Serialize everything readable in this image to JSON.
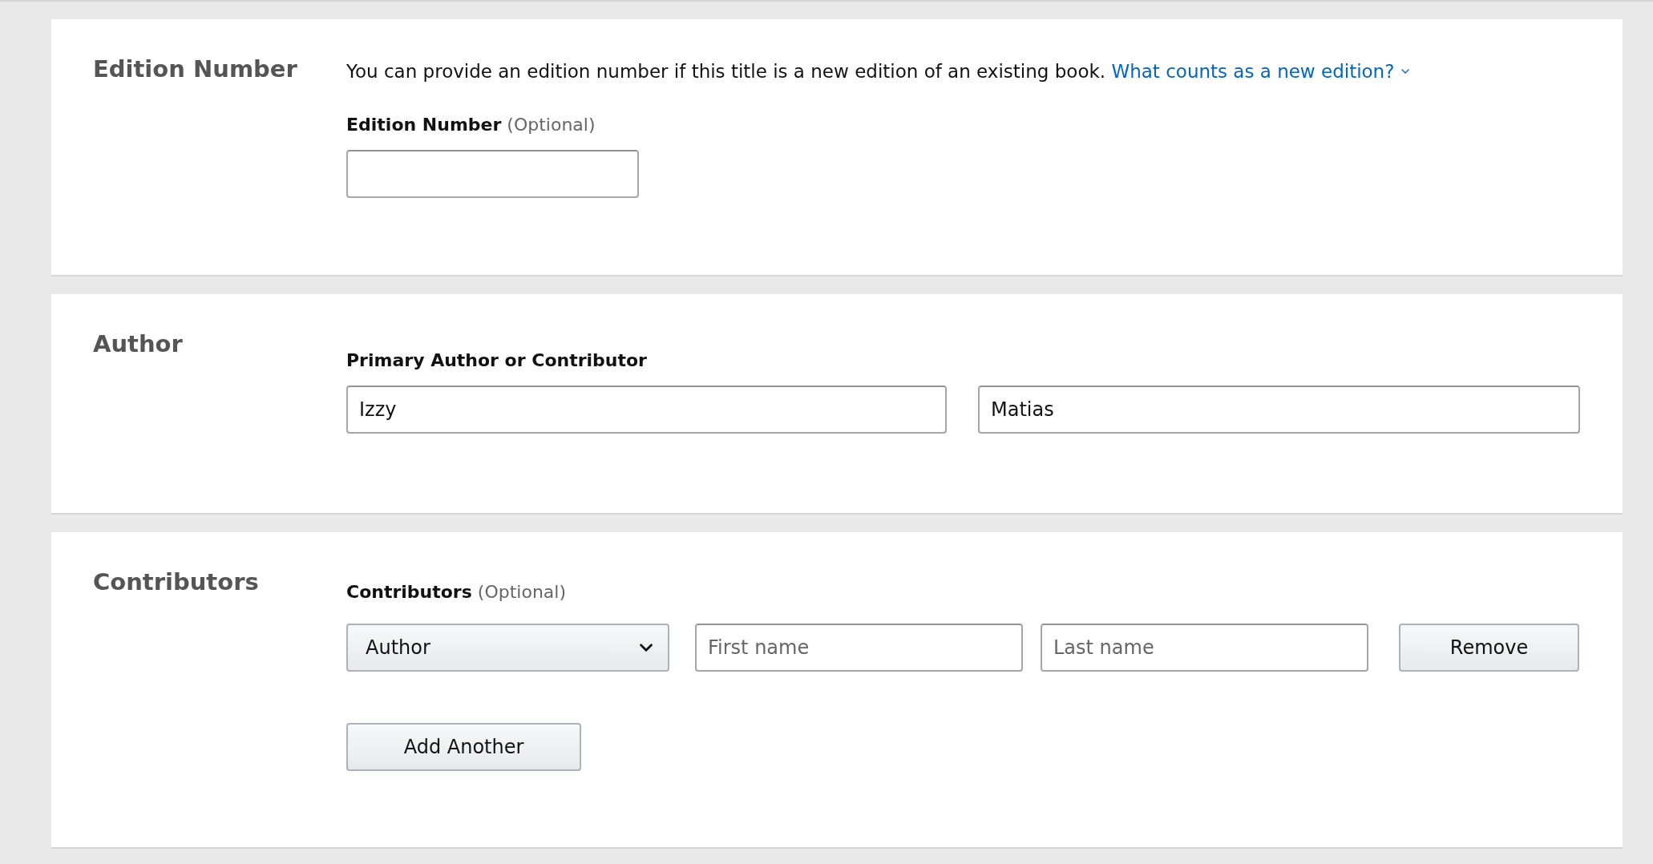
{
  "edition_section": {
    "heading": "Edition Number",
    "description": "You can provide an edition number if this title is a new edition of an existing book.",
    "help_link": "What counts as a new edition?",
    "label": "Edition Number",
    "label_note": "(Optional)"
  },
  "author_section": {
    "heading": "Author",
    "label": "Primary Author or Contributor",
    "first_name": {
      "value": "Izzy"
    },
    "last_name": {
      "value": "Matias"
    }
  },
  "contributors_section": {
    "heading": "Contributors",
    "label": "Contributors",
    "label_note": "(Optional)",
    "rows": [
      {
        "role": "Author",
        "first_name": {
          "placeholder": "First name"
        },
        "last_name": {
          "placeholder": "Last name"
        },
        "remove_button": "Remove"
      }
    ],
    "add_button": "Add Another"
  }
}
